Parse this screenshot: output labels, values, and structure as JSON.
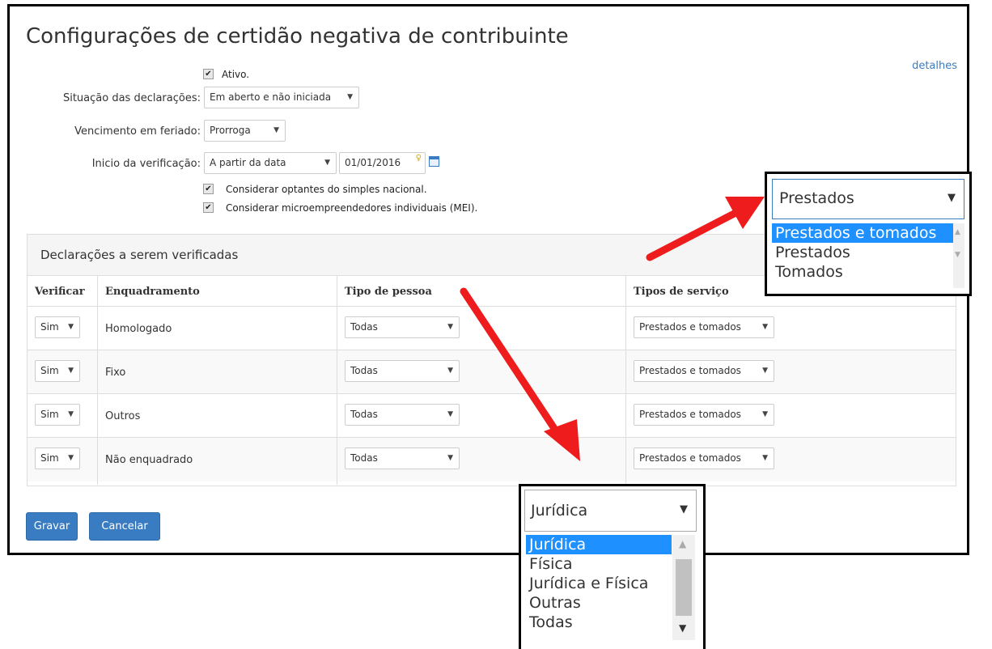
{
  "page_title": "Configurações de certidão negativa de contribuinte",
  "details_link": "detalhes",
  "form": {
    "ativo_label": "Ativo.",
    "situacao_label": "Situação das declarações:",
    "situacao_value": "Em aberto e não iniciada",
    "vencimento_label": "Vencimento em feriado:",
    "vencimento_value": "Prorroga",
    "inicio_label": "Inicio da verificação:",
    "inicio_value": "A partir da data",
    "inicio_date": "01/01/2016",
    "simples_label": "Considerar optantes do simples nacional.",
    "mei_label": "Considerar microempreendedores individuais (MEI)."
  },
  "panel": {
    "title": "Declarações a serem verificadas",
    "headers": [
      "Verificar",
      "Enquadramento",
      "Tipo de pessoa",
      "Tipos de serviço"
    ],
    "rows": [
      {
        "verificar": "Sim",
        "enquadramento": "Homologado",
        "tipo": "Todas",
        "servico": "Prestados e tomados"
      },
      {
        "verificar": "Sim",
        "enquadramento": "Fixo",
        "tipo": "Todas",
        "servico": "Prestados e tomados"
      },
      {
        "verificar": "Sim",
        "enquadramento": "Outros",
        "tipo": "Todas",
        "servico": "Prestados e tomados"
      },
      {
        "verificar": "Sim",
        "enquadramento": "Não enquadrado",
        "tipo": "Todas",
        "servico": "Prestados e tomados"
      }
    ]
  },
  "buttons": {
    "save": "Gravar",
    "cancel": "Cancelar"
  },
  "popup_servico": {
    "selected": "Prestados",
    "options": [
      "Prestados e tomados",
      "Prestados",
      "Tomados"
    ],
    "highlighted": 0
  },
  "popup_pessoa": {
    "selected": "Jurídica",
    "options": [
      "Jurídica",
      "Física",
      "Jurídica e Física",
      "Outras",
      "Todas"
    ],
    "highlighted": 0
  },
  "colors": {
    "accent": "#3a7cc1",
    "highlight": "#1e90ff",
    "arrow": "#ee1c1c"
  },
  "icons": {
    "checkbox": "checkmark",
    "calendar": "calendar-icon",
    "dropdown": "triangle-down"
  }
}
